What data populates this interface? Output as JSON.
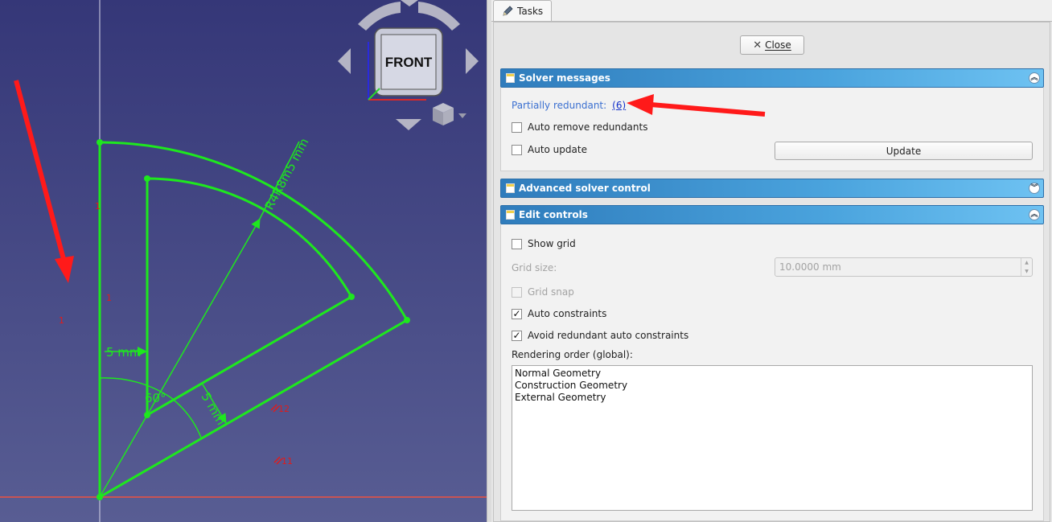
{
  "viewport": {
    "navcube": {
      "face_label": "FRONT"
    },
    "dimensions": {
      "radius_label": "R4R8m5 mm",
      "width_label": "5 mm",
      "gap_label": "5 mm",
      "angle_label": "60°"
    },
    "constraint_labels": {
      "c1": "1",
      "c2": "1",
      "c3": "1",
      "c12": "12",
      "c11": "11"
    }
  },
  "tasks_panel": {
    "tab_label": "Tasks",
    "close_label": "Close",
    "solver_messages": {
      "title": "Solver messages",
      "partially_redundant_label": "Partially redundant:",
      "partially_redundant_link": "(6)",
      "auto_remove_label": "Auto remove redundants",
      "auto_remove_checked": false,
      "auto_update_label": "Auto update",
      "auto_update_checked": false,
      "update_button_label": "Update"
    },
    "advanced_solver": {
      "title": "Advanced solver control"
    },
    "edit_controls": {
      "title": "Edit controls",
      "show_grid_label": "Show grid",
      "show_grid_checked": false,
      "grid_size_label": "Grid size:",
      "grid_size_value": "10.0000 mm",
      "grid_snap_label": "Grid snap",
      "auto_constraints_label": "Auto constraints",
      "auto_constraints_checked": true,
      "avoid_redundant_label": "Avoid redundant auto constraints",
      "avoid_redundant_checked": true,
      "rendering_order_label": "Rendering order (global):",
      "rendering_order_items": [
        "Normal Geometry",
        "Construction Geometry",
        "External Geometry"
      ]
    }
  },
  "colors": {
    "geometry": "#1ee81e",
    "constraint": "#e01b1b",
    "panel_header": "#3f92d2",
    "link": "#1330c9"
  }
}
